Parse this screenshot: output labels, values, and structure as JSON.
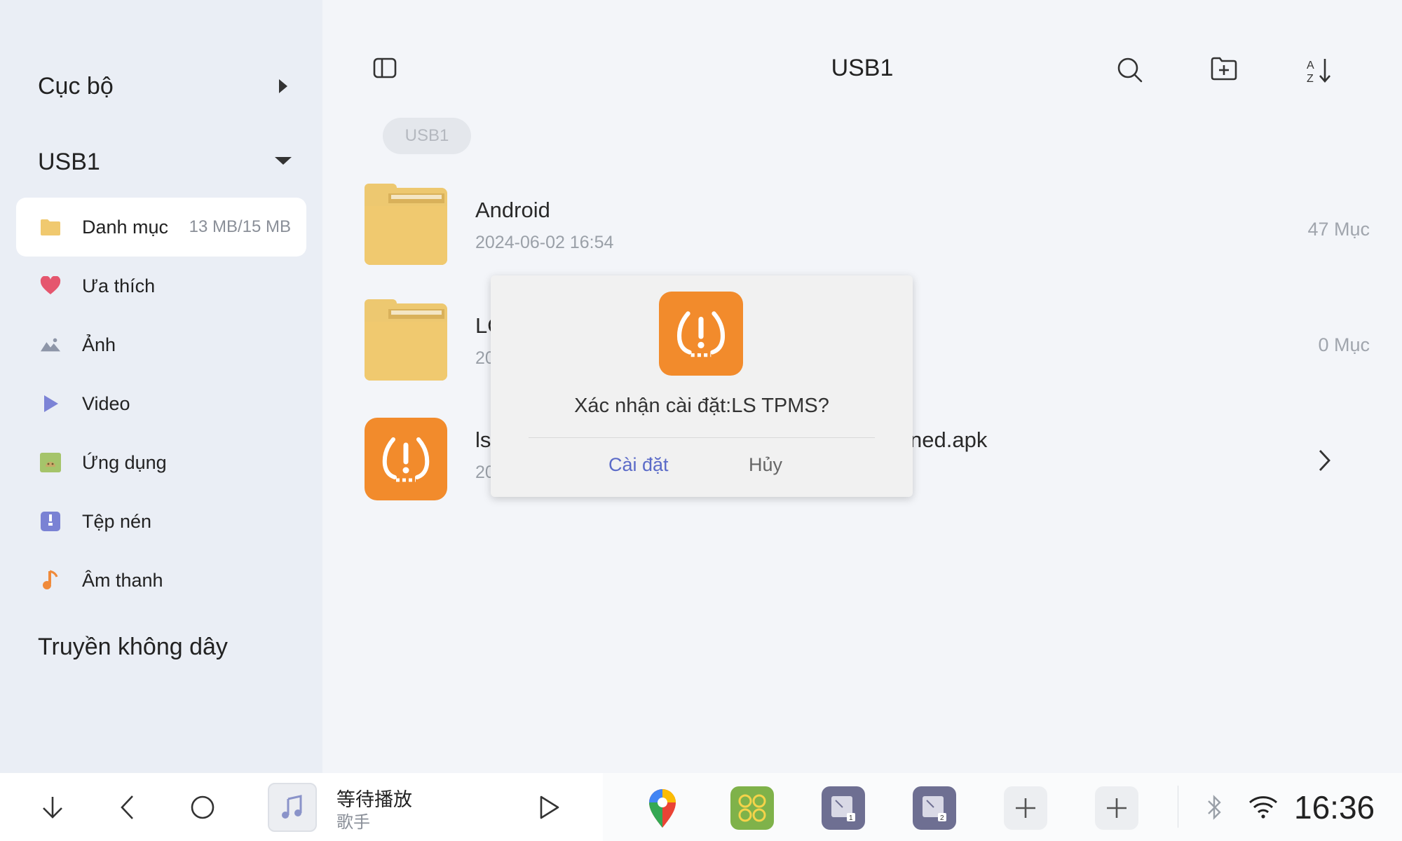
{
  "sidebar": {
    "local_label": "Cục bộ",
    "usb_label": "USB1",
    "items": [
      {
        "label": "Danh mục",
        "meta": "13 MB/15 MB",
        "icon": "folder-icon"
      },
      {
        "label": "Ưa thích",
        "icon": "heart-icon"
      },
      {
        "label": "Ảnh",
        "icon": "image-icon"
      },
      {
        "label": "Video",
        "icon": "play-icon"
      },
      {
        "label": "Ứng dụng",
        "icon": "android-icon"
      },
      {
        "label": "Tệp nén",
        "icon": "archive-icon"
      },
      {
        "label": "Âm thanh",
        "icon": "music-note-icon"
      }
    ],
    "wireless_label": "Truyền không dây"
  },
  "header": {
    "title": "USB1",
    "breadcrumb": "USB1"
  },
  "files": [
    {
      "name": "Android",
      "date": "2024-06-02 16:54",
      "count": "47 Mục",
      "icon": "folder-icon"
    },
    {
      "name": "LO",
      "date": "20",
      "count": "0 Mục",
      "icon": "folder-icon"
    },
    {
      "name": "ls",
      "name_suffix": "ned.apk",
      "date": "20",
      "icon": "tpms-app-icon"
    }
  ],
  "dialog": {
    "message": "Xác nhận cài đặt:LS TPMS?",
    "confirm_label": "Cài đặt",
    "cancel_label": "Hủy"
  },
  "media": {
    "song": "等待播放",
    "artist": "歌手"
  },
  "status": {
    "time": "16:36"
  },
  "colors": {
    "accent": "#5b6bc8",
    "tpms_orange": "#f28b2c",
    "folder": "#f0c96f",
    "sidebar_bg": "#eaeef5",
    "page_bg": "#f3f5f9"
  }
}
